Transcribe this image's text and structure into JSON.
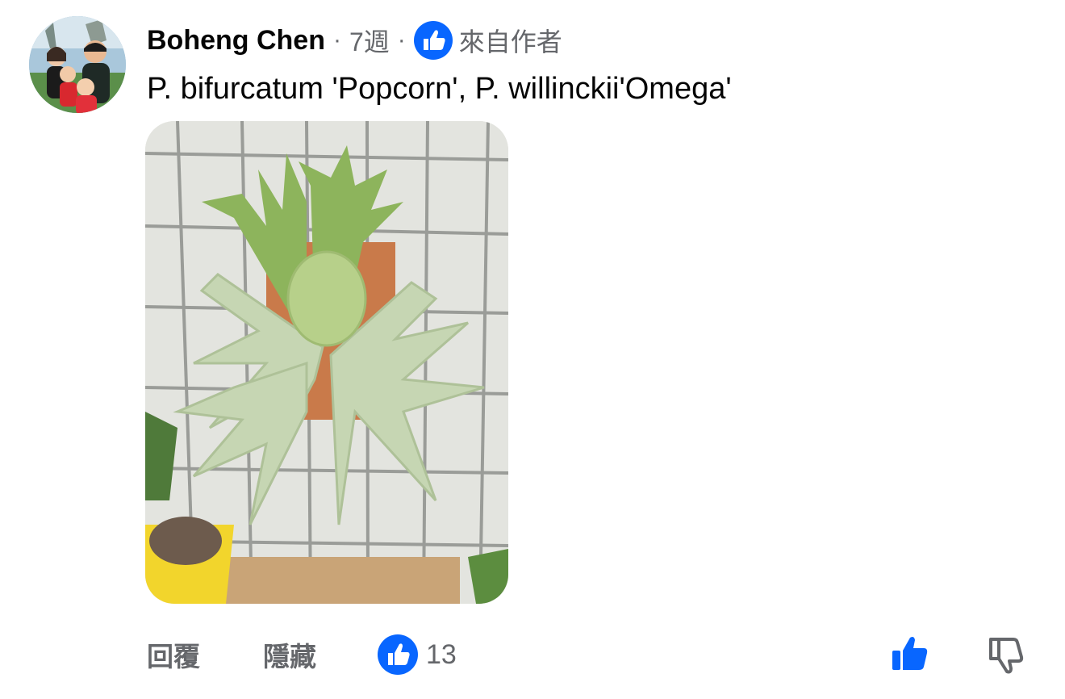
{
  "comment": {
    "author": "Boheng Chen",
    "separator": "·",
    "time": "7週",
    "author_badge": {
      "icon": "thumbs-up-icon",
      "label": "來自作者"
    },
    "text": "P. bifurcatum 'Popcorn', P. willinckii'Omega'",
    "attachment": {
      "type": "photo",
      "subject": "staghorn-fern-photo"
    }
  },
  "actions": {
    "reply_label": "回覆",
    "hide_label": "隱藏",
    "reaction_icon": "like-reaction-icon",
    "reaction_count": "13",
    "like_icon": "thumbs-up-icon",
    "dislike_icon": "thumbs-down-icon"
  },
  "colors": {
    "accent": "#0866ff",
    "secondary_text": "#65676b",
    "primary_text": "#050505"
  }
}
